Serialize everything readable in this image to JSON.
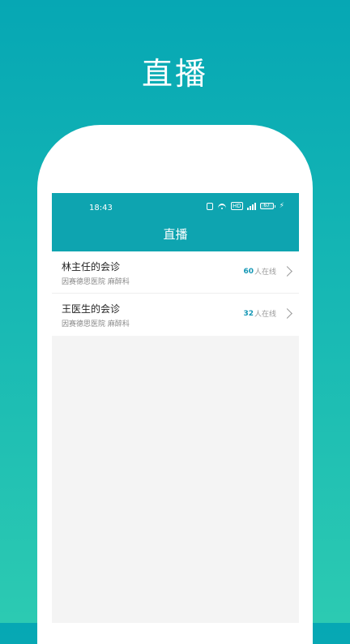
{
  "hero": {
    "title": "直播"
  },
  "status_bar": {
    "time": "18:43",
    "network_badge": "HD",
    "battery_level": "67"
  },
  "nav": {
    "title": "直播"
  },
  "list": {
    "items": [
      {
        "title": "林主任的会诊",
        "subtitle": "因赛德思医院 麻醉科",
        "online_count": "60",
        "online_label": "人在线"
      },
      {
        "title": "王医生的会诊",
        "subtitle": "因赛德思医院 麻醉科",
        "online_count": "32",
        "online_label": "人在线"
      }
    ]
  },
  "colors": {
    "accent": "#0ea4b0",
    "background_top": "#06a7b4",
    "background_bottom": "#2ccab2",
    "count_blue": "#1397b5"
  },
  "icons": [
    "nfc-icon",
    "wifi-icon",
    "signal-icon",
    "battery-icon",
    "bolt-icon",
    "chevron-right-icon"
  ]
}
